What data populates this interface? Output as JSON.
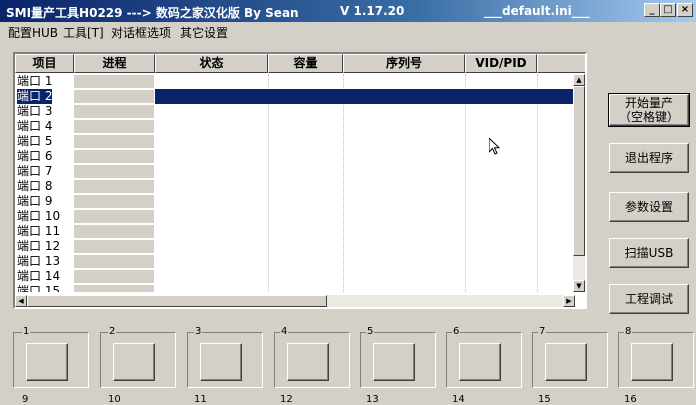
{
  "title": {
    "main": "SMI量产工具H0229 ---> 数码之家汉化版 By Sean",
    "version": "V 1.17.20",
    "ini": "___default.ini___"
  },
  "window_controls": {
    "minimize": "_",
    "maximize": "□",
    "close": "×"
  },
  "menu": [
    "配置HUB",
    "工具[T]",
    "对话框选项",
    "其它设置"
  ],
  "list": {
    "columns": [
      "项目",
      "进程",
      "状态",
      "容量",
      "序列号",
      "VID/PID"
    ],
    "rows": [
      "端口 1",
      "端口 2",
      "端口 3",
      "端口 4",
      "端口 5",
      "端口 6",
      "端口 7",
      "端口 8",
      "端口 9",
      "端口 10",
      "端口 11",
      "端口 12",
      "端口 13",
      "端口 14",
      "端口 15"
    ],
    "selected_row": 1
  },
  "buttons": {
    "start_line1": "开始量产",
    "start_line2": "（空格键）",
    "exit": "退出程序",
    "params": "参数设置",
    "scan": "扫描USB",
    "debug": "工程调试"
  },
  "ports": [
    "1",
    "2",
    "3",
    "4",
    "5",
    "6",
    "7",
    "8"
  ],
  "ports_row2": [
    "9",
    "10",
    "11",
    "12",
    "13",
    "14",
    "15",
    "16"
  ],
  "colors": {
    "titlebar": "#0a246a",
    "selection": "#0a246a",
    "face": "#d4d0c8"
  }
}
